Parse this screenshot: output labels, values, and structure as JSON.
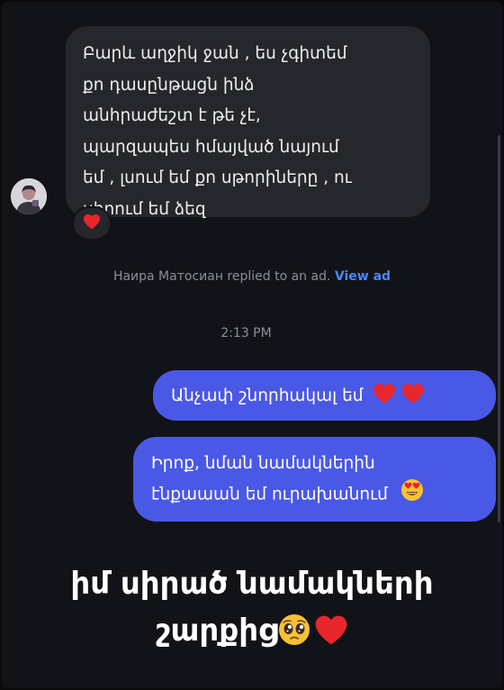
{
  "conversation": {
    "incoming_message": {
      "lines": [
        "Բարև աղջիկ ջան , ես չգիտեմ",
        "քո դասընթացն ինձ",
        "անհրաժեշտ է թե չէ,",
        "պարզապես հմայված նայում",
        "եմ , լսում եմ քո սթորիները , ու",
        "սիրում եմ ձեզ"
      ],
      "reaction_icon": "red-heart-emoji"
    },
    "ad_reply_note": {
      "text": "Наира Матосиан replied to an ad.",
      "link_label": "View ad",
      "link_color": "#4c86f5"
    },
    "timestamp": "2:13 PM",
    "outgoing_messages": [
      {
        "text": "Անչափ շնորհակալ եմ",
        "emoji_icons": [
          "red-heart-emoji",
          "red-heart-emoji"
        ]
      },
      {
        "lines": [
          "Իրոք, նման նամակներին",
          "էնքաաան եմ ուրախանում"
        ],
        "emoji_icons": [
          "heart-eyes-emoji"
        ]
      }
    ],
    "colors": {
      "background": "#121318",
      "incoming_bubble": "#26272c",
      "outgoing_bubble": "#4a58e6"
    }
  },
  "caption": {
    "line1": "իմ սիրած նամակների",
    "line2": "շարքից",
    "emoji_icons": [
      "pleading-face-emoji",
      "red-heart-emoji"
    ]
  }
}
